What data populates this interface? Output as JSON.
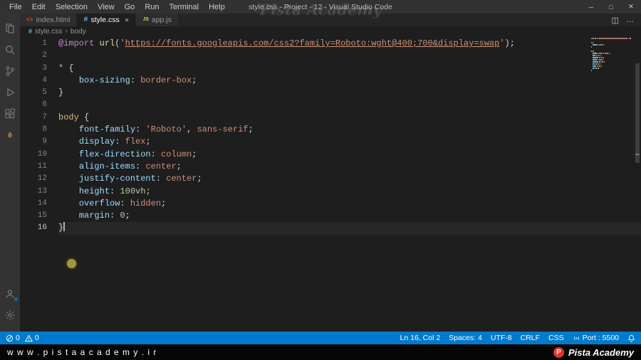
{
  "titlebar": {
    "menus": [
      "File",
      "Edit",
      "Selection",
      "View",
      "Go",
      "Run",
      "Terminal",
      "Help"
    ],
    "title": "style.css - Project - 12 - Visual Studio Code"
  },
  "watermark": "Pista Academy",
  "icons": {
    "minimize": "─",
    "maximize": "□",
    "close": "✕",
    "split_editor": "◫",
    "more_actions": "…",
    "tab_close": "✕",
    "chevron": "›",
    "html_tag": "<>",
    "css_hash": "#",
    "js": "JS"
  },
  "tabs": {
    "items": [
      {
        "label": "index.html"
      },
      {
        "label": "style.css"
      },
      {
        "label": "app.js"
      }
    ]
  },
  "breadcrumb": {
    "file": "style.css",
    "symbol": "body"
  },
  "editor": {
    "lines": [
      {
        "n": 1,
        "tokens": [
          [
            "@import",
            "kw"
          ],
          [
            " ",
            "pl"
          ],
          [
            "url",
            "fn"
          ],
          [
            "(",
            "pl"
          ],
          [
            "'",
            "str"
          ],
          [
            "https://fonts.googleapis.com/css2?family=Roboto:wght@400;700&display=swap",
            "link"
          ],
          [
            "'",
            "str"
          ],
          [
            ")",
            "pl"
          ],
          [
            ";",
            "pl"
          ]
        ]
      },
      {
        "n": 2,
        "tokens": []
      },
      {
        "n": 3,
        "tokens": [
          [
            "*",
            "sel"
          ],
          [
            " {",
            "pl"
          ]
        ]
      },
      {
        "n": 4,
        "tokens": [
          [
            "    ",
            "pl"
          ],
          [
            "box-sizing",
            "prop"
          ],
          [
            ": ",
            "pl"
          ],
          [
            "border-box",
            "val"
          ],
          [
            ";",
            "pl"
          ]
        ]
      },
      {
        "n": 5,
        "tokens": [
          [
            "}",
            "pl"
          ]
        ]
      },
      {
        "n": 6,
        "tokens": []
      },
      {
        "n": 7,
        "tokens": [
          [
            "body",
            "sel"
          ],
          [
            " {",
            "pl"
          ]
        ]
      },
      {
        "n": 8,
        "tokens": [
          [
            "    ",
            "pl"
          ],
          [
            "font-family",
            "prop"
          ],
          [
            ": ",
            "pl"
          ],
          [
            "'Roboto'",
            "str"
          ],
          [
            ", ",
            "pl"
          ],
          [
            "sans-serif",
            "val"
          ],
          [
            ";",
            "pl"
          ]
        ]
      },
      {
        "n": 9,
        "tokens": [
          [
            "    ",
            "pl"
          ],
          [
            "display",
            "prop"
          ],
          [
            ": ",
            "pl"
          ],
          [
            "flex",
            "val"
          ],
          [
            ";",
            "pl"
          ]
        ]
      },
      {
        "n": 10,
        "tokens": [
          [
            "    ",
            "pl"
          ],
          [
            "flex-direction",
            "prop"
          ],
          [
            ": ",
            "pl"
          ],
          [
            "column",
            "val"
          ],
          [
            ";",
            "pl"
          ]
        ]
      },
      {
        "n": 11,
        "tokens": [
          [
            "    ",
            "pl"
          ],
          [
            "align-items",
            "prop"
          ],
          [
            ": ",
            "pl"
          ],
          [
            "center",
            "val"
          ],
          [
            ";",
            "pl"
          ]
        ]
      },
      {
        "n": 12,
        "tokens": [
          [
            "    ",
            "pl"
          ],
          [
            "justify-content",
            "prop"
          ],
          [
            ": ",
            "pl"
          ],
          [
            "center",
            "val"
          ],
          [
            ";",
            "pl"
          ]
        ]
      },
      {
        "n": 13,
        "tokens": [
          [
            "    ",
            "pl"
          ],
          [
            "height",
            "prop"
          ],
          [
            ": ",
            "pl"
          ],
          [
            "100vh",
            "num"
          ],
          [
            ";",
            "pl"
          ]
        ]
      },
      {
        "n": 14,
        "tokens": [
          [
            "    ",
            "pl"
          ],
          [
            "overflow",
            "prop"
          ],
          [
            ": ",
            "pl"
          ],
          [
            "hidden",
            "val"
          ],
          [
            ";",
            "pl"
          ]
        ]
      },
      {
        "n": 15,
        "tokens": [
          [
            "    ",
            "pl"
          ],
          [
            "margin",
            "prop"
          ],
          [
            ": ",
            "pl"
          ],
          [
            "0",
            "num"
          ],
          [
            ";",
            "pl"
          ]
        ]
      },
      {
        "n": 16,
        "tokens": [
          [
            "}",
            "pl"
          ]
        ],
        "cursor": true
      }
    ]
  },
  "statusbar": {
    "errors": "0",
    "warnings": "0",
    "cursor": "Ln 16, Col 2",
    "indentation": "Spaces: 4",
    "encoding": "UTF-8",
    "eol": "CRLF",
    "language": "CSS",
    "port": "Port : 5500"
  },
  "footer": {
    "url": "w w w . p i s t a a c a d e m y . i r",
    "brand": "Pista Academy"
  },
  "colors": {
    "accent": "#007acc",
    "statusbar_bg": "#007acc",
    "titlebar_bg": "#323233",
    "activitybar_bg": "#333333",
    "tabbar_bg": "#252526",
    "editor_bg": "#1e1e1e",
    "footer_bg": "#050505",
    "brand_red": "#e63329"
  }
}
